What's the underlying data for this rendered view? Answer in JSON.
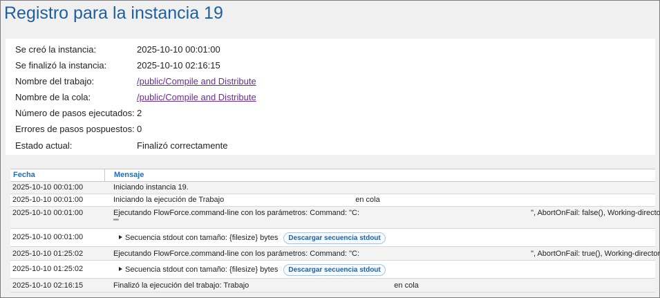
{
  "title": "Registro para la instancia 19",
  "summary": [
    {
      "label": "Se creó la instancia:",
      "value": "2025-10-10 00:01:00"
    },
    {
      "label": "Se finalizó la instancia:",
      "value": "2025-10-10 02:16:15"
    },
    {
      "label": "Nombre del trabajo:",
      "value": "/public/Compile and Distribute"
    },
    {
      "label": "Nombre de la cola:",
      "value": "/public/Compile and Distribute"
    },
    {
      "label": "Número de pasos ejecutados:",
      "value": "2"
    },
    {
      "label": "Errores de pasos pospuestos:",
      "value": "0"
    },
    {
      "label": "Estado actual:",
      "value": "Finalizó correctamente"
    }
  ],
  "log": {
    "col_fecha": "Fecha",
    "col_mensaje": "Mensaje",
    "rows": [
      {
        "date": "2025-10-10 00:01:00",
        "msg": "Iniciando instancia 19."
      },
      {
        "date": "2025-10-10 00:01:00",
        "msg_a": "Iniciando la ejecución de Trabajo",
        "msg_b": "en cola"
      },
      {
        "date": "2025-10-10 00:01:00",
        "msg_a": "Ejecutando FlowForce.command-line con los parámetros: Command: \"C:",
        "msg_b": "\", AbortOnFail: false(), Working-directory:",
        "msg_c": "\"\""
      },
      {
        "date": "2025-10-10 00:01:00",
        "msg": "Secuencia stdout con tamaño: {filesize} bytes",
        "button": "Descargar secuencia stdout"
      },
      {
        "date": "2025-10-10 01:25:02",
        "msg_a": "Ejecutando FlowForce.command-line con los parámetros: Command: \"C:",
        "msg_b": "\", AbortOnFail: true(), Working-directory: \"\""
      },
      {
        "date": "2025-10-10 01:25:02",
        "msg": "Secuencia stdout con tamaño: {filesize} bytes",
        "button": "Descargar secuencia stdout"
      },
      {
        "date": "2025-10-10 02:16:15",
        "msg_a": "Finalizó la ejecución del trabajo: Trabajo",
        "msg_b": "en cola"
      }
    ]
  }
}
